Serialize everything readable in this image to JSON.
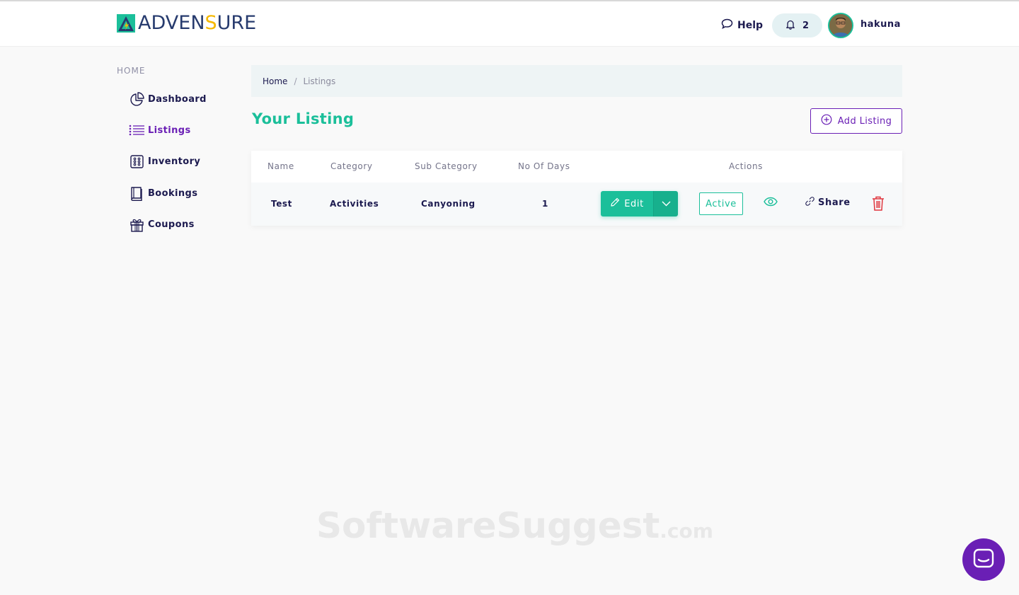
{
  "header": {
    "logo_text_a": "ADVEN",
    "logo_text_b": "S",
    "logo_text_c": "URE",
    "help_label": "Help",
    "notification_count": "2",
    "username": "hakuna"
  },
  "sidebar": {
    "heading": "HOME",
    "items": [
      {
        "label": "Dashboard",
        "icon": "pie-chart-icon"
      },
      {
        "label": "Listings",
        "icon": "list-icon",
        "active": true
      },
      {
        "label": "Inventory",
        "icon": "grid-dots-icon"
      },
      {
        "label": "Bookings",
        "icon": "book-icon"
      },
      {
        "label": "Coupons",
        "icon": "gift-icon"
      }
    ]
  },
  "breadcrumb": {
    "home": "Home",
    "separator": "/",
    "current": "Listings"
  },
  "main": {
    "title": "Your Listing",
    "add_button_label": "Add Listing"
  },
  "table": {
    "columns": [
      "Name",
      "Category",
      "Sub Category",
      "No Of Days",
      "Actions"
    ],
    "rows": [
      {
        "name": "Test",
        "category": "Activities",
        "sub_category": "Canyoning",
        "days": "1",
        "edit_label": "Edit",
        "status_label": "Active",
        "share_label": "Share"
      }
    ]
  },
  "watermark": {
    "text": "SoftwareSuggest",
    "suffix": ".com"
  },
  "colors": {
    "accent_green": "#1bbf9a",
    "accent_purple": "#6a1fb5",
    "text_dark": "#1c1a4f",
    "danger": "#e0353d"
  }
}
